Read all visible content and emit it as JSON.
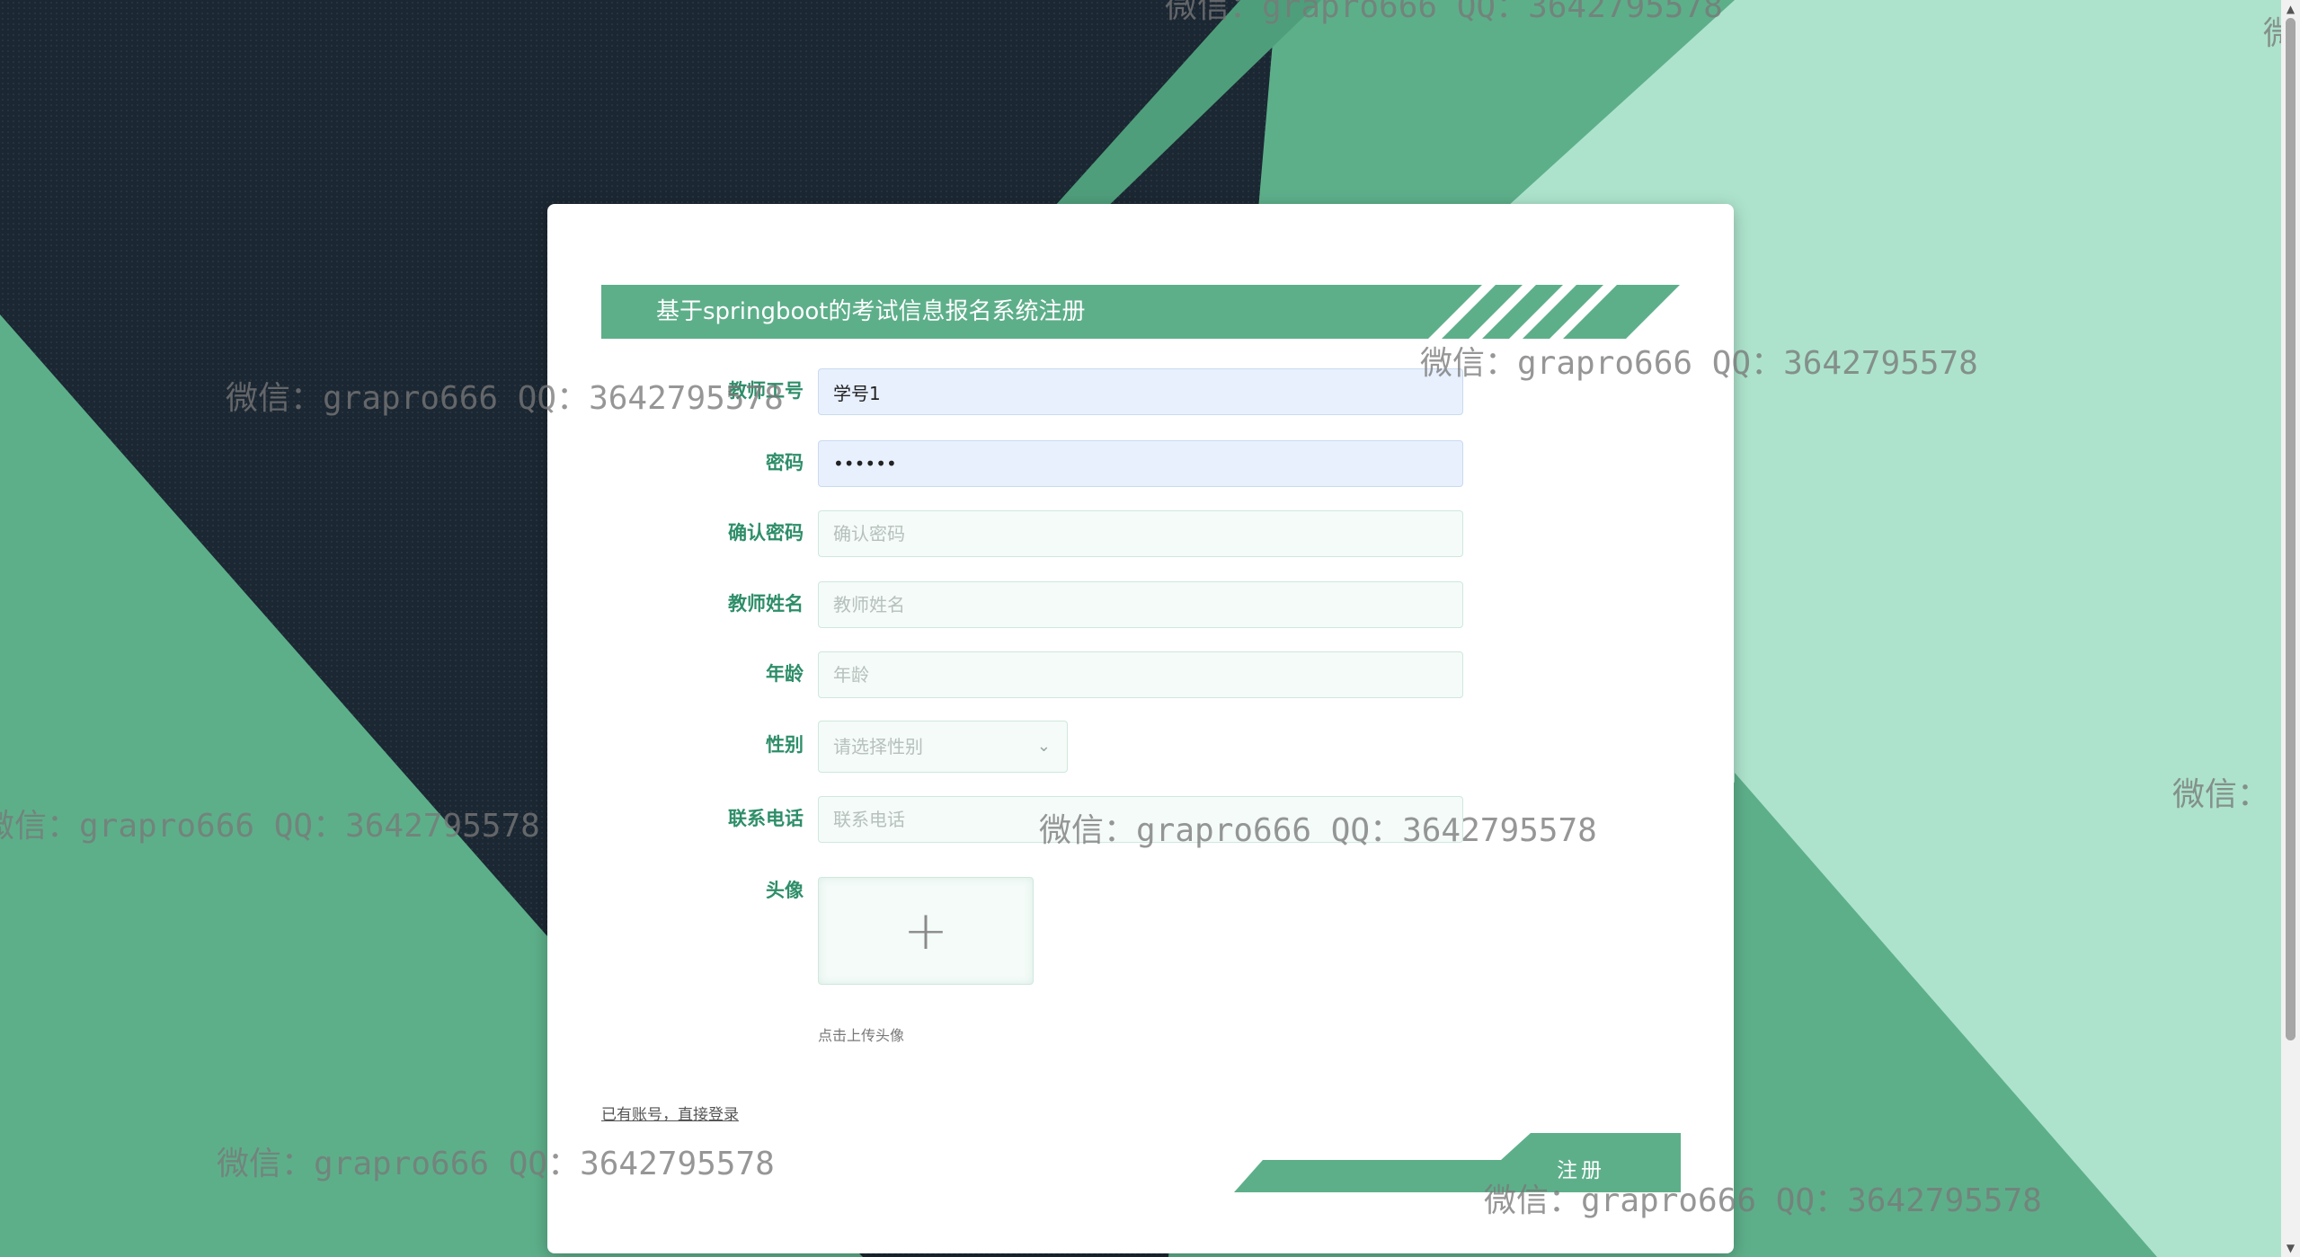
{
  "form": {
    "title": "基于springboot的考试信息报名系统注册",
    "fields": [
      {
        "label": "教师工号",
        "value": "学号1",
        "placeholder": ""
      },
      {
        "label": "密码",
        "value": "••••••",
        "placeholder": ""
      },
      {
        "label": "确认密码",
        "value": "",
        "placeholder": "确认密码"
      },
      {
        "label": "教师姓名",
        "value": "",
        "placeholder": "教师姓名"
      },
      {
        "label": "年龄",
        "value": "",
        "placeholder": "年龄"
      },
      {
        "label": "性别",
        "value": "",
        "placeholder": "请选择性别"
      },
      {
        "label": "联系电话",
        "value": "",
        "placeholder": "联系电话"
      },
      {
        "label": "头像",
        "value": "",
        "placeholder": ""
      }
    ],
    "upload_plus": "+",
    "upload_hint": "点击上传头像",
    "login_link": "已有账号，直接登录",
    "register_button": "注册",
    "select_chevron": "⌄"
  },
  "watermark": {
    "text": "微信：grapro666 QQ：3642795578",
    "short": "微信："
  },
  "scrollbar": {
    "up_arrow": "▲",
    "down_arrow": "▼"
  },
  "colors": {
    "accent_green": "#5daf8a",
    "dark_bg": "#1b2732",
    "mint_bg": "#ade3cc",
    "label_green": "#2e8e69"
  }
}
